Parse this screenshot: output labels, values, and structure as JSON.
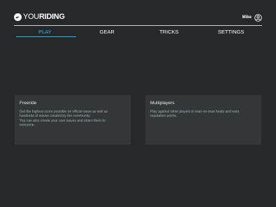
{
  "app": {
    "logo_you": "YOU",
    "logo_riding": "RIDING"
  },
  "user": {
    "name": "Mike"
  },
  "tabs": [
    {
      "label": "PLAY",
      "active": true
    },
    {
      "label": "GEAR",
      "active": false
    },
    {
      "label": "TRICKS",
      "active": false
    },
    {
      "label": "SETTINGS",
      "active": false
    }
  ],
  "modes": [
    {
      "title": "Freeride",
      "lines": [
        "Get the highest score possible on official wave as well as",
        "hundreds of waves created by the community.",
        "You can also create your own waves and share them to",
        "everyone."
      ]
    },
    {
      "title": "Multiplayers",
      "lines": [
        "Play against other players in man-on-man heats and earn",
        "reputation points."
      ]
    }
  ],
  "colors": {
    "background": "#25292b",
    "card": "#33373a",
    "accent": "#34b6e4",
    "text": "#ffffff"
  },
  "icons": {
    "logo": "youriding-logo-icon",
    "user": "user-avatar-icon"
  }
}
